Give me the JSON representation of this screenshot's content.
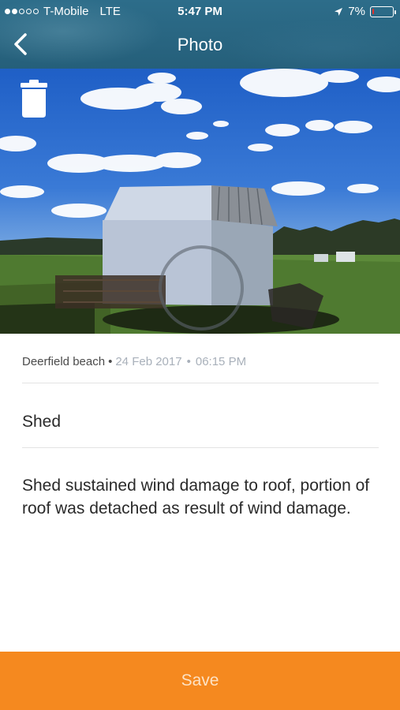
{
  "status_bar": {
    "carrier": "T-Mobile",
    "network": "LTE",
    "time": "5:47 PM",
    "battery": "7%",
    "battery_level": 0.07
  },
  "nav": {
    "title": "Photo",
    "back_icon": "chevron-left-icon"
  },
  "photo": {
    "delete_icon": "trash-icon"
  },
  "details": {
    "location": "Deerfield beach",
    "date": "24 Feb 2017",
    "time": "06:15 PM",
    "title": "Shed",
    "description": "Shed sustained wind damage to roof, portion of roof was detached as result of wind damage."
  },
  "actions": {
    "save_label": "Save"
  },
  "colors": {
    "header": "#2d6d8a",
    "save_bar": "#f5891f",
    "battery_low": "#e0312b"
  }
}
